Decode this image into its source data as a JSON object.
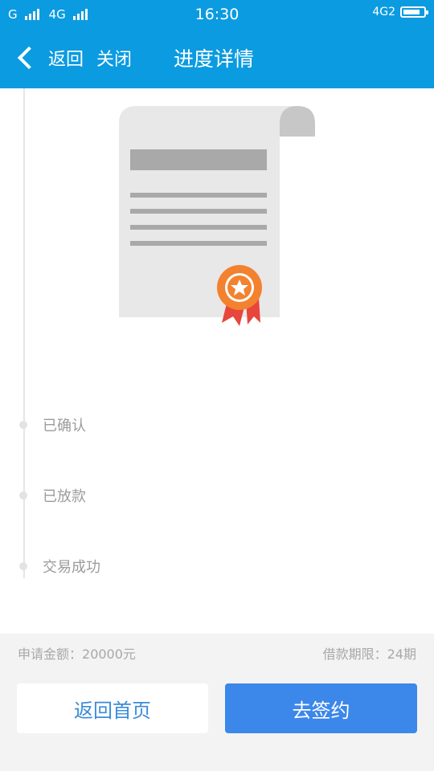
{
  "status_bar": {
    "signal_left": "G",
    "network": "4G",
    "time": "16:30",
    "network_right": "4G2",
    "battery_level": 0.85
  },
  "nav": {
    "back_label": "返回",
    "close_label": "关闭",
    "title": "进度详情"
  },
  "steps": [
    {
      "label": "已确认"
    },
    {
      "label": "已放款"
    },
    {
      "label": "交易成功"
    }
  ],
  "summary": {
    "amount_label": "申请金额：",
    "amount_value": "20000元",
    "term_label": "借款期限：",
    "term_value": "24期"
  },
  "buttons": {
    "home": "返回首页",
    "sign": "去签约"
  },
  "colors": {
    "header_bg": "#0b9be0",
    "primary_button": "#3c87ea",
    "badge_orange": "#f2822f",
    "ribbon_red": "#e8453c"
  },
  "icons": [
    "chevron-left-icon",
    "document-certificate-icon",
    "award-badge-icon"
  ]
}
